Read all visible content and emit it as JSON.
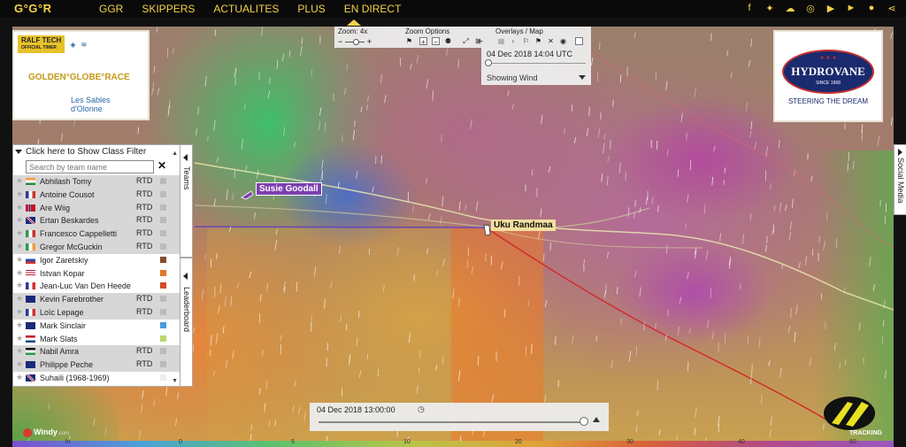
{
  "header": {
    "logo": "G°G°R",
    "nav": [
      "GGR",
      "SKIPPERS",
      "ACTUALITES",
      "PLUS",
      "EN DIRECT"
    ],
    "social_icons": [
      "facebook-icon",
      "twitter-icon",
      "soundcloud-icon",
      "instagram-icon",
      "youtube-icon",
      "play-icon",
      "flickr-icon",
      "share-icon"
    ],
    "accent": "#f3d34a"
  },
  "sponsors": {
    "left": {
      "ralf_tech": "RALF TECH",
      "ralf_tech_sub": "OFFICIAL TIMER",
      "race": "GOLDEN°GLOBE°RACE",
      "city_line1": "Les Sables",
      "city_line2": "d'Olonne"
    },
    "right": {
      "brand": "HYDROVANE",
      "since": "SINCE 1968",
      "tagline": "STEERING THE DREAM"
    }
  },
  "controls": {
    "zoom_label": "Zoom: 4x",
    "zoom_options_label": "Zoom Options",
    "overlays_label": "Overlays / Map",
    "datetime": "04 Dec 2018 14:04 UTC",
    "overlay_selected": "Showing Wind"
  },
  "panel": {
    "filter_label": "Click here to Show Class Filter",
    "search_placeholder": "Search by team name",
    "teams_tab": "Teams",
    "leaderboard_tab": "Leaderboard",
    "rows": [
      {
        "name": "Abhilash Tomy",
        "status": "RTD",
        "shaded": true,
        "flag": "in",
        "color": "#bbbbbb"
      },
      {
        "name": "Antoine Cousot",
        "status": "RTD",
        "shaded": true,
        "flag": "fr",
        "color": "#bbbbbb"
      },
      {
        "name": "Are Wiig",
        "status": "RTD",
        "shaded": true,
        "flag": "no",
        "color": "#bbbbbb"
      },
      {
        "name": "Ertan Beskardes",
        "status": "RTD",
        "shaded": true,
        "flag": "gb",
        "color": "#bbbbbb"
      },
      {
        "name": "Francesco Cappelletti",
        "status": "RTD",
        "shaded": true,
        "flag": "it",
        "color": "#bbbbbb"
      },
      {
        "name": "Gregor McGuckin",
        "status": "RTD",
        "shaded": true,
        "flag": "ie",
        "color": "#bbbbbb"
      },
      {
        "name": "Igor Zaretskiy",
        "status": "",
        "shaded": false,
        "flag": "ru",
        "color": "#8a4a2a"
      },
      {
        "name": "Istvan Kopar",
        "status": "",
        "shaded": false,
        "flag": "us",
        "color": "#e0762a"
      },
      {
        "name": "Jean-Luc Van Den Heede",
        "status": "",
        "shaded": false,
        "flag": "fr",
        "color": "#d24a2a"
      },
      {
        "name": "Kevin Farebrother",
        "status": "RTD",
        "shaded": true,
        "flag": "au",
        "color": "#bbbbbb"
      },
      {
        "name": "Loïc Lepage",
        "status": "RTD",
        "shaded": true,
        "flag": "fr",
        "color": "#bbbbbb"
      },
      {
        "name": "Mark Sinclair",
        "status": "",
        "shaded": false,
        "flag": "au",
        "color": "#4a9ad8"
      },
      {
        "name": "Mark Slats",
        "status": "",
        "shaded": false,
        "flag": "nl",
        "color": "#b8d86a"
      },
      {
        "name": "Nabil Amra",
        "status": "RTD",
        "shaded": true,
        "flag": "ps",
        "color": "#bbbbbb"
      },
      {
        "name": "Philippe Peche",
        "status": "RTD",
        "shaded": true,
        "flag": "au",
        "color": "#bbbbbb"
      },
      {
        "name": "Suhaili (1968-1969)",
        "status": "",
        "shaded": false,
        "flag": "gb",
        "color": "#eeeeee"
      }
    ]
  },
  "map": {
    "boats": {
      "susie": "Susie Goodall",
      "uku": "Uku Randmaa"
    },
    "social_tab": "Social Media",
    "windy": "Windy",
    "windy_sub": ".com",
    "tracking": "TRACKING"
  },
  "timeline": {
    "datetime": "04 Dec 2018 13:00:00"
  },
  "legend": {
    "ticks": [
      "kt",
      "0",
      "5",
      "10",
      "20",
      "30",
      "40",
      "60"
    ]
  }
}
